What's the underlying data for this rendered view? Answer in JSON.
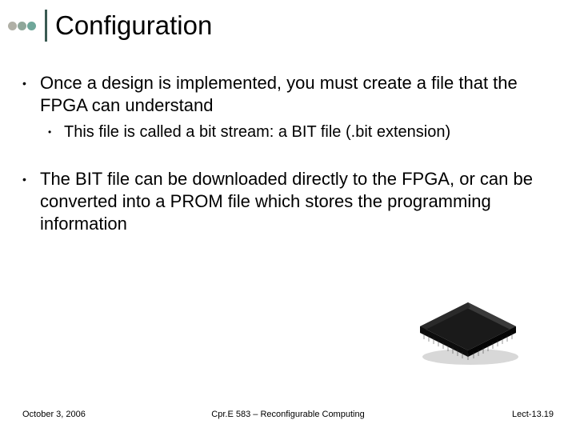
{
  "title": "Configuration",
  "bullets": [
    {
      "level": 1,
      "text": "Once a design is implemented, you must create a file that the FPGA can understand"
    },
    {
      "level": 2,
      "text": "This file is called a bit stream: a BIT file (.bit extension)"
    },
    {
      "level": 1,
      "text": "The BIT file can be downloaded directly to the FPGA, or can be converted into a PROM file which stores the programming information"
    }
  ],
  "footer": {
    "left": "October 3, 2006",
    "center": "Cpr.E 583 – Reconfigurable Computing",
    "right": "Lect-13.19"
  }
}
